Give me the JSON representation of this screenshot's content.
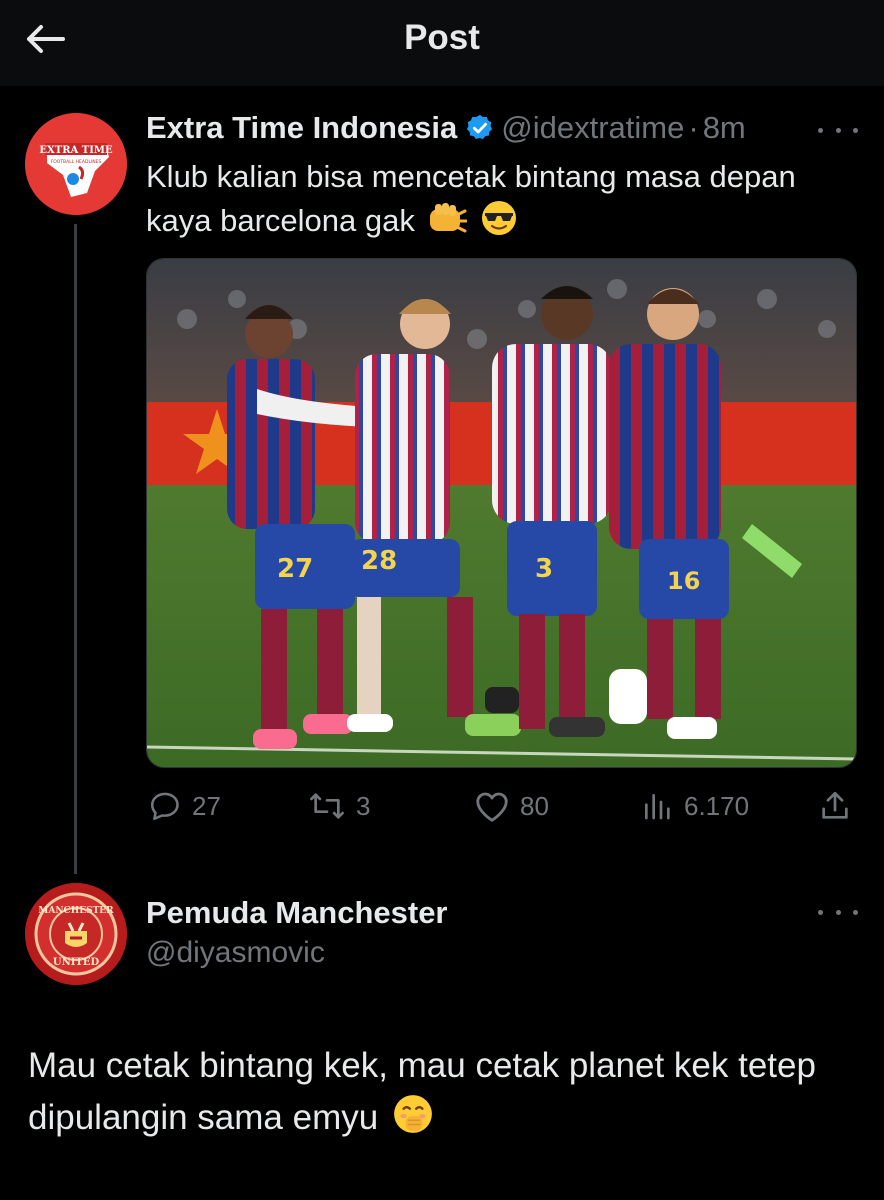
{
  "header": {
    "title": "Post",
    "back_icon": "arrow-left-icon"
  },
  "tweet": {
    "display_name": "Extra Time Indonesia",
    "verified_icon": "verified-badge-icon",
    "handle": "@idextratime",
    "separator": "·",
    "time": "8m",
    "text": "Klub kalian bisa mencetak bintang masa depan kaya barcelona gak",
    "emojis": [
      "fist-bump-emoji",
      "sunglasses-emoji"
    ],
    "avatar_text": {
      "top": "EXTRA TIME",
      "sub": "FOOTBALL HEADLINES"
    },
    "media": {
      "description_icon": "photo",
      "jersey_numbers": [
        "27",
        "28",
        "3",
        "16"
      ]
    },
    "stats": {
      "replies": "27",
      "retweets": "3",
      "likes": "80",
      "views": "6.170"
    }
  },
  "reply": {
    "display_name": "Pemuda Manchester",
    "handle": "@diyasmovic",
    "avatar_text": {
      "top": "MANCHESTER",
      "bottom": "UNITED"
    },
    "text": "Mau cetak bintang kek, mau cetak planet kek tetep dipulangin sama emyu",
    "emoji": "hand-over-mouth-emoji"
  },
  "colors": {
    "background": "#000000",
    "text": "#e7e9ea",
    "muted": "#71767b",
    "verified": "#1d9bf0"
  }
}
